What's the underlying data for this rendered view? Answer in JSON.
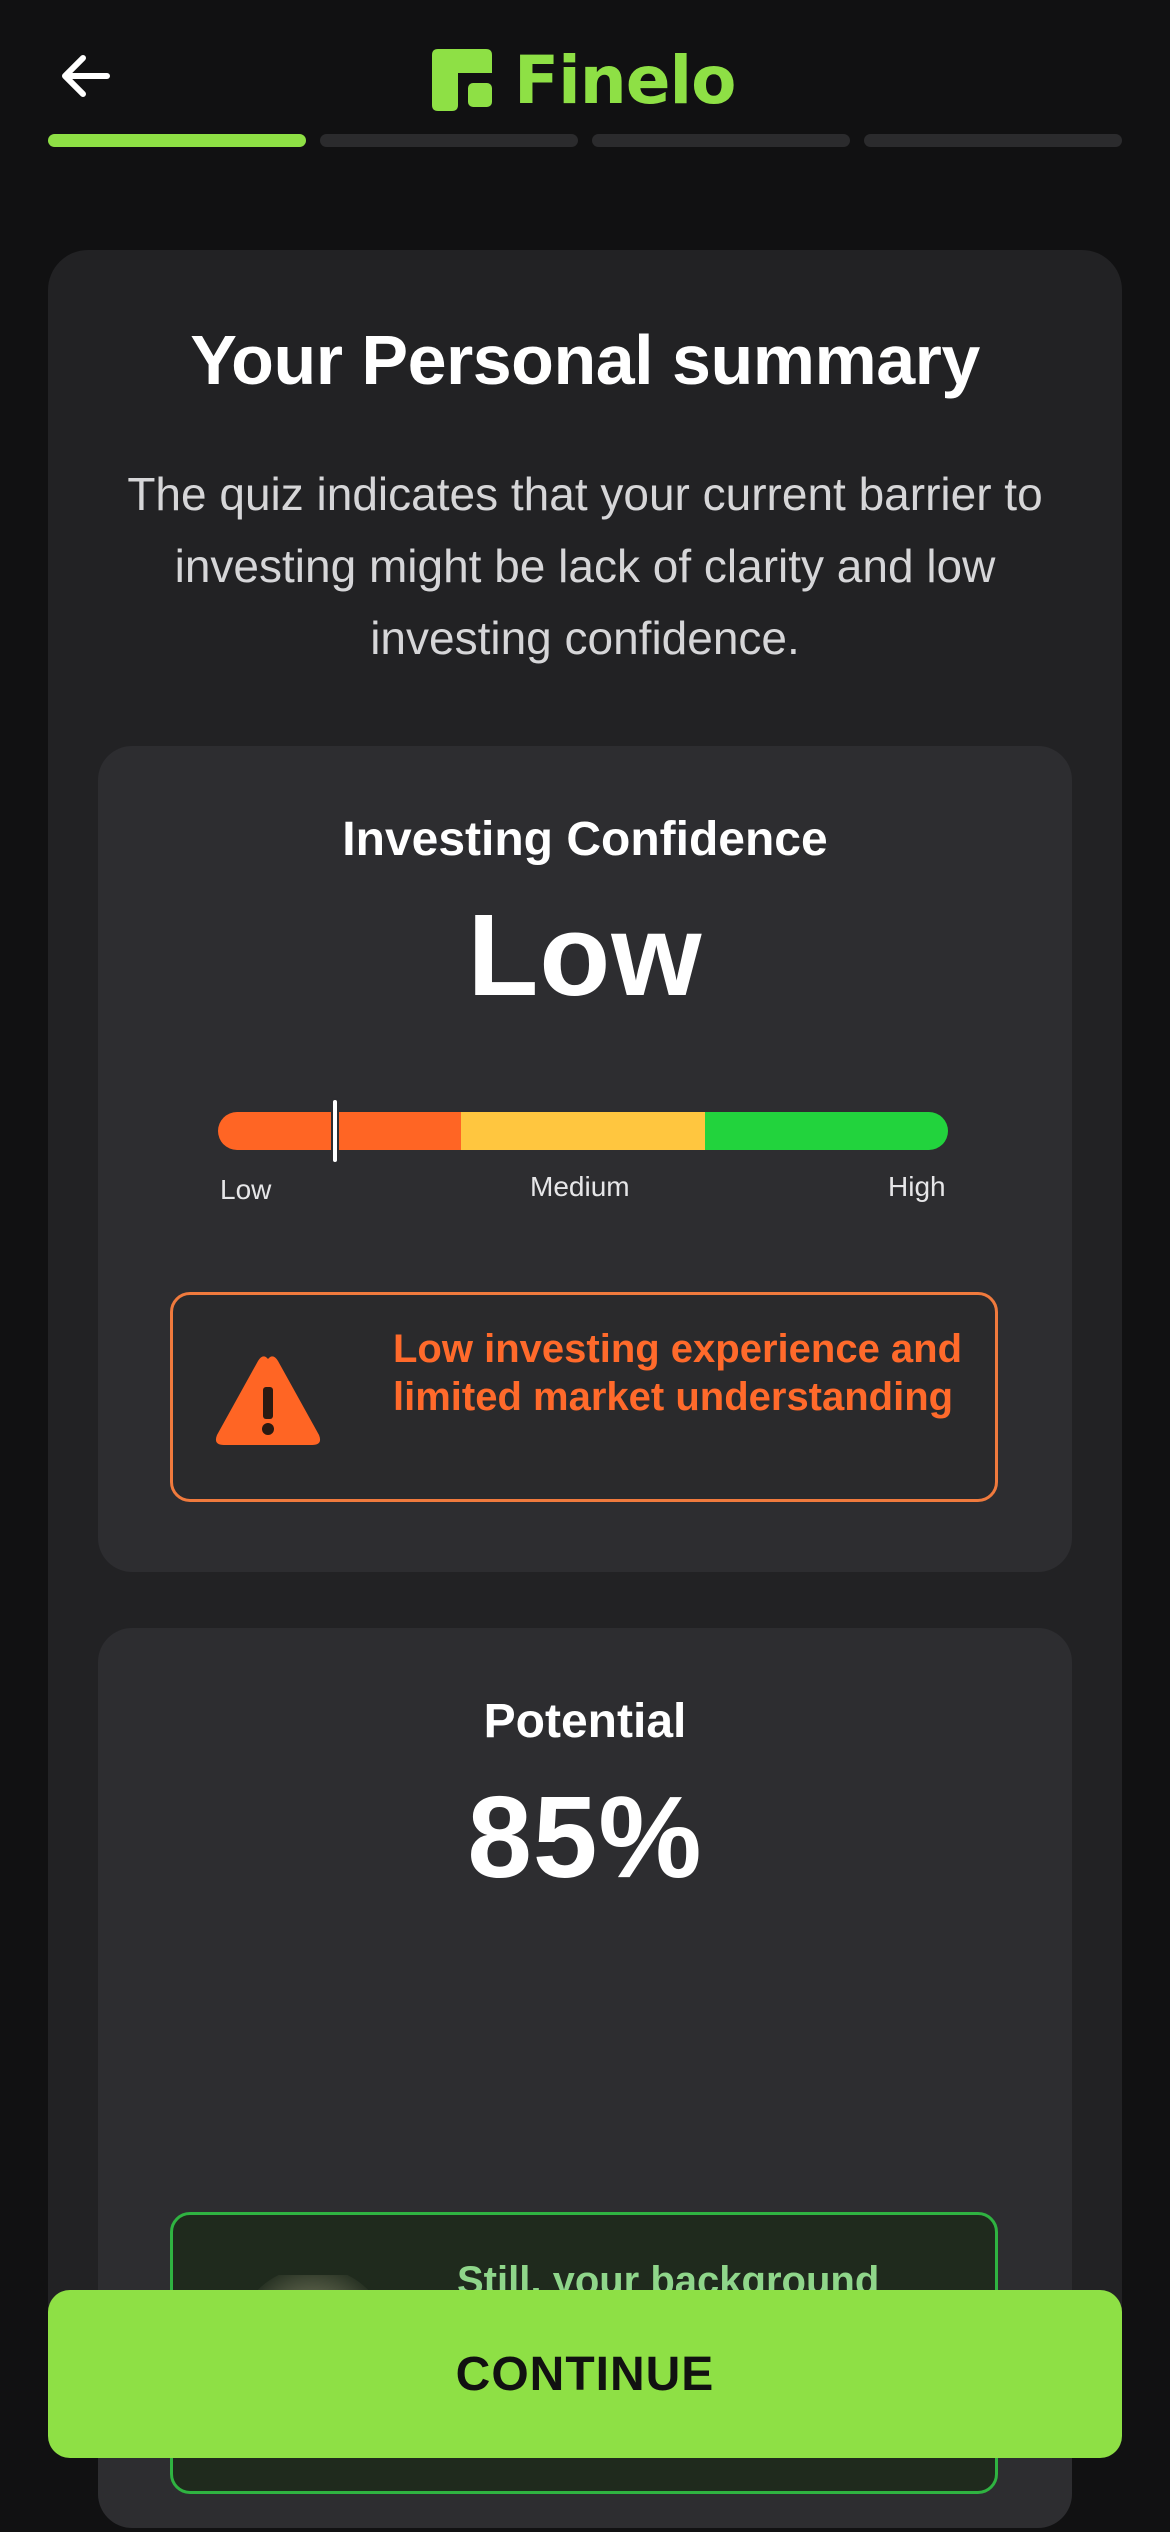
{
  "header": {
    "back_icon": "arrow-left-icon",
    "logo_text": "Finelo",
    "brand_color": "#8ee045"
  },
  "progress": {
    "total_steps": 4,
    "current_step": 1
  },
  "summary": {
    "title": "Your Personal summary",
    "description": "The quiz indicates that your current barrier to investing might be lack of clarity and low investing confidence."
  },
  "confidence": {
    "label": "Investing Confidence",
    "value": "Low",
    "meter": {
      "level": 0.16,
      "segments": [
        {
          "name": "low",
          "color": "#ff6524"
        },
        {
          "name": "medium",
          "color": "#ffc63f"
        },
        {
          "name": "high",
          "color": "#22d33d"
        }
      ],
      "labels": {
        "low": "Low",
        "medium": "Medium",
        "high": "High"
      }
    },
    "warning": {
      "icon": "warning-triangle-icon",
      "text": "Low investing experience and limited market understanding",
      "color": "#ff6a2b"
    }
  },
  "potential": {
    "label": "Potential",
    "value": "85%",
    "tip": {
      "icon": "lightbulb-icon",
      "text": "Still, your background indicates perfect mindset to start investing with AI",
      "color": "#8fd68a"
    }
  },
  "continue_button": {
    "label": "CONTINUE"
  }
}
